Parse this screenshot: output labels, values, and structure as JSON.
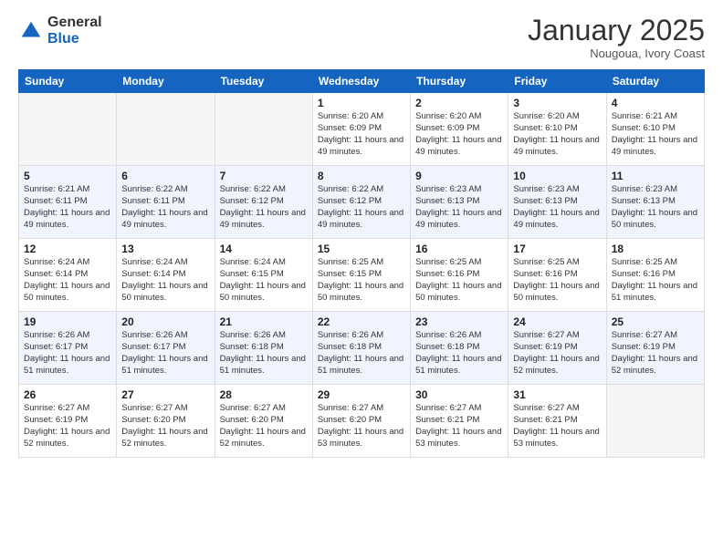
{
  "header": {
    "logo_general": "General",
    "logo_blue": "Blue",
    "month_title": "January 2025",
    "subtitle": "Nougoua, Ivory Coast"
  },
  "days_of_week": [
    "Sunday",
    "Monday",
    "Tuesday",
    "Wednesday",
    "Thursday",
    "Friday",
    "Saturday"
  ],
  "weeks": [
    [
      {
        "day": "",
        "info": ""
      },
      {
        "day": "",
        "info": ""
      },
      {
        "day": "",
        "info": ""
      },
      {
        "day": "1",
        "info": "Sunrise: 6:20 AM\nSunset: 6:09 PM\nDaylight: 11 hours and 49 minutes."
      },
      {
        "day": "2",
        "info": "Sunrise: 6:20 AM\nSunset: 6:09 PM\nDaylight: 11 hours and 49 minutes."
      },
      {
        "day": "3",
        "info": "Sunrise: 6:20 AM\nSunset: 6:10 PM\nDaylight: 11 hours and 49 minutes."
      },
      {
        "day": "4",
        "info": "Sunrise: 6:21 AM\nSunset: 6:10 PM\nDaylight: 11 hours and 49 minutes."
      }
    ],
    [
      {
        "day": "5",
        "info": "Sunrise: 6:21 AM\nSunset: 6:11 PM\nDaylight: 11 hours and 49 minutes."
      },
      {
        "day": "6",
        "info": "Sunrise: 6:22 AM\nSunset: 6:11 PM\nDaylight: 11 hours and 49 minutes."
      },
      {
        "day": "7",
        "info": "Sunrise: 6:22 AM\nSunset: 6:12 PM\nDaylight: 11 hours and 49 minutes."
      },
      {
        "day": "8",
        "info": "Sunrise: 6:22 AM\nSunset: 6:12 PM\nDaylight: 11 hours and 49 minutes."
      },
      {
        "day": "9",
        "info": "Sunrise: 6:23 AM\nSunset: 6:13 PM\nDaylight: 11 hours and 49 minutes."
      },
      {
        "day": "10",
        "info": "Sunrise: 6:23 AM\nSunset: 6:13 PM\nDaylight: 11 hours and 49 minutes."
      },
      {
        "day": "11",
        "info": "Sunrise: 6:23 AM\nSunset: 6:13 PM\nDaylight: 11 hours and 50 minutes."
      }
    ],
    [
      {
        "day": "12",
        "info": "Sunrise: 6:24 AM\nSunset: 6:14 PM\nDaylight: 11 hours and 50 minutes."
      },
      {
        "day": "13",
        "info": "Sunrise: 6:24 AM\nSunset: 6:14 PM\nDaylight: 11 hours and 50 minutes."
      },
      {
        "day": "14",
        "info": "Sunrise: 6:24 AM\nSunset: 6:15 PM\nDaylight: 11 hours and 50 minutes."
      },
      {
        "day": "15",
        "info": "Sunrise: 6:25 AM\nSunset: 6:15 PM\nDaylight: 11 hours and 50 minutes."
      },
      {
        "day": "16",
        "info": "Sunrise: 6:25 AM\nSunset: 6:16 PM\nDaylight: 11 hours and 50 minutes."
      },
      {
        "day": "17",
        "info": "Sunrise: 6:25 AM\nSunset: 6:16 PM\nDaylight: 11 hours and 50 minutes."
      },
      {
        "day": "18",
        "info": "Sunrise: 6:25 AM\nSunset: 6:16 PM\nDaylight: 11 hours and 51 minutes."
      }
    ],
    [
      {
        "day": "19",
        "info": "Sunrise: 6:26 AM\nSunset: 6:17 PM\nDaylight: 11 hours and 51 minutes."
      },
      {
        "day": "20",
        "info": "Sunrise: 6:26 AM\nSunset: 6:17 PM\nDaylight: 11 hours and 51 minutes."
      },
      {
        "day": "21",
        "info": "Sunrise: 6:26 AM\nSunset: 6:18 PM\nDaylight: 11 hours and 51 minutes."
      },
      {
        "day": "22",
        "info": "Sunrise: 6:26 AM\nSunset: 6:18 PM\nDaylight: 11 hours and 51 minutes."
      },
      {
        "day": "23",
        "info": "Sunrise: 6:26 AM\nSunset: 6:18 PM\nDaylight: 11 hours and 51 minutes."
      },
      {
        "day": "24",
        "info": "Sunrise: 6:27 AM\nSunset: 6:19 PM\nDaylight: 11 hours and 52 minutes."
      },
      {
        "day": "25",
        "info": "Sunrise: 6:27 AM\nSunset: 6:19 PM\nDaylight: 11 hours and 52 minutes."
      }
    ],
    [
      {
        "day": "26",
        "info": "Sunrise: 6:27 AM\nSunset: 6:19 PM\nDaylight: 11 hours and 52 minutes."
      },
      {
        "day": "27",
        "info": "Sunrise: 6:27 AM\nSunset: 6:20 PM\nDaylight: 11 hours and 52 minutes."
      },
      {
        "day": "28",
        "info": "Sunrise: 6:27 AM\nSunset: 6:20 PM\nDaylight: 11 hours and 52 minutes."
      },
      {
        "day": "29",
        "info": "Sunrise: 6:27 AM\nSunset: 6:20 PM\nDaylight: 11 hours and 53 minutes."
      },
      {
        "day": "30",
        "info": "Sunrise: 6:27 AM\nSunset: 6:21 PM\nDaylight: 11 hours and 53 minutes."
      },
      {
        "day": "31",
        "info": "Sunrise: 6:27 AM\nSunset: 6:21 PM\nDaylight: 11 hours and 53 minutes."
      },
      {
        "day": "",
        "info": ""
      }
    ]
  ]
}
